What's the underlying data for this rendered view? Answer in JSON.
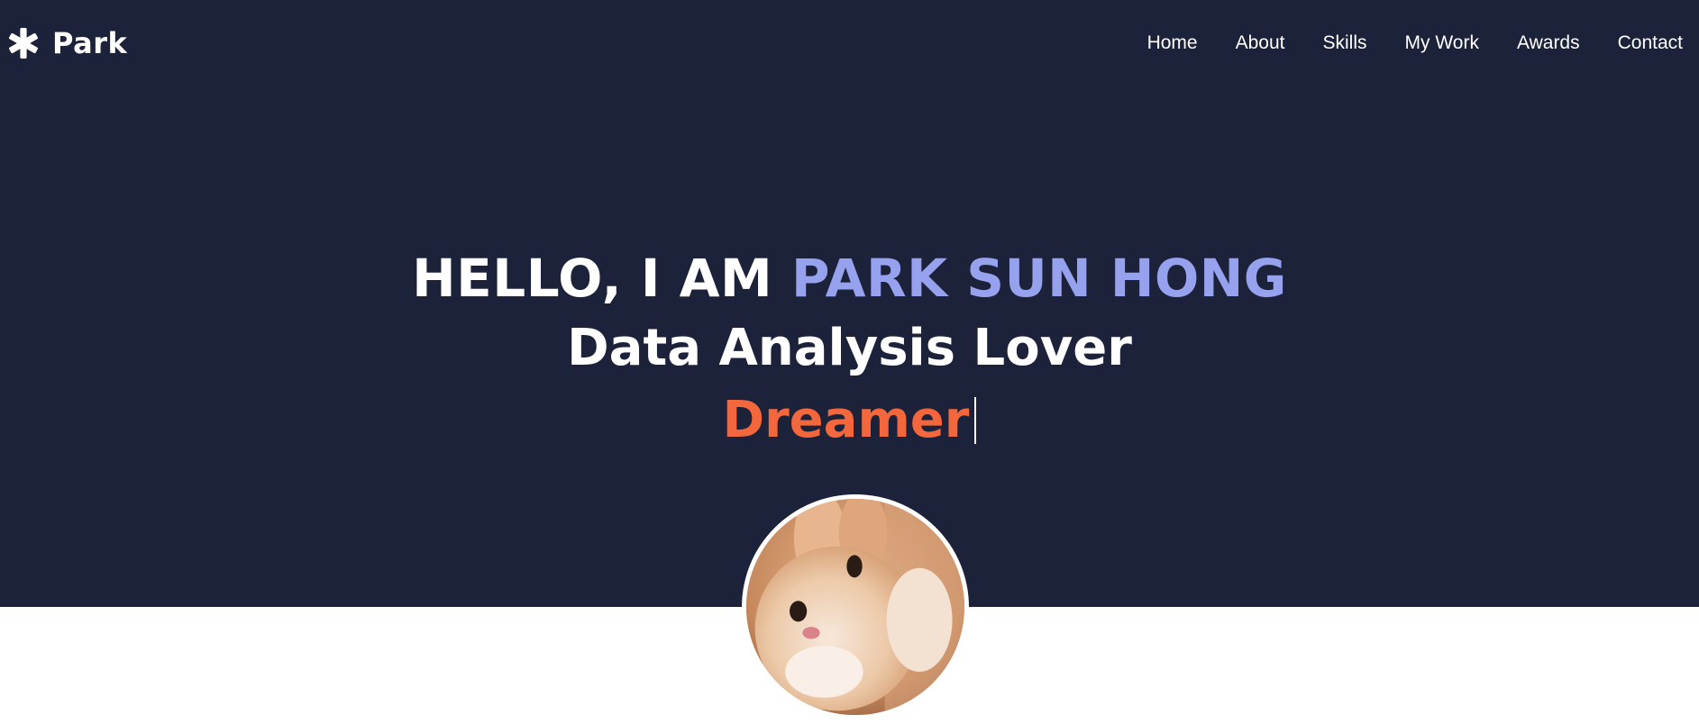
{
  "navbar": {
    "brand_icon": "asterisk-icon",
    "brand_name": "Park",
    "links": [
      "Home",
      "About",
      "Skills",
      "My Work",
      "Awards",
      "Contact"
    ]
  },
  "hero": {
    "greeting": "HELLO, I AM ",
    "name": "PARK SUN HONG",
    "subtitle": "Data Analysis Lover",
    "typed_word": "Dreamer"
  },
  "avatar": {
    "alt": "bunny-avatar"
  },
  "colors": {
    "hero_background": "#1c2239",
    "name_accent": "#97a2ee",
    "typed_accent": "#f4673c"
  }
}
